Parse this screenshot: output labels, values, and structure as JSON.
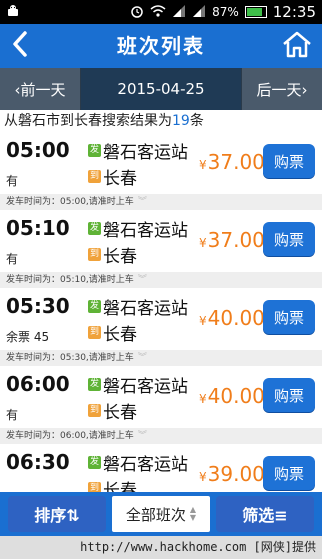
{
  "statusbar": {
    "battery_percent": "87%",
    "battery_level": 0.87,
    "time": "12:35",
    "icons": [
      "android-icon",
      "alarm-icon",
      "wifi-icon",
      "signal-icon",
      "signal-icon",
      "battery-icon"
    ]
  },
  "header": {
    "title": "班次列表",
    "back_icon": "back-arrow-icon",
    "home_icon": "home-icon",
    "color": "#1a6fd1"
  },
  "datenav": {
    "prev": "‹前一天",
    "date": "2015-04-25",
    "next": "后一天›"
  },
  "summary": {
    "prefix": "从磐石市到长春搜索结果为",
    "count": "19",
    "suffix": "条"
  },
  "trips": [
    {
      "time": "05:00",
      "avail": "有",
      "from": "磐石客运站",
      "to": "长春",
      "price": "37.00",
      "buy": "购票",
      "dep": "发车时间为：05:00,请准时上车"
    },
    {
      "time": "05:10",
      "avail": "有",
      "from": "磐石客运站",
      "to": "长春",
      "price": "37.00",
      "buy": "购票",
      "dep": "发车时间为：05:10,请准时上车"
    },
    {
      "time": "05:30",
      "avail": "余票 45",
      "from": "磐石客运站",
      "to": "长春",
      "price": "40.00",
      "buy": "购票",
      "dep": "发车时间为：05:30,请准时上车"
    },
    {
      "time": "06:00",
      "avail": "有",
      "from": "磐石客运站",
      "to": "长春",
      "price": "40.00",
      "buy": "购票",
      "dep": "发车时间为：06:00,请准时上车"
    },
    {
      "time": "06:30",
      "avail": "",
      "from": "磐石客运站",
      "to": "长春",
      "price": "39.00",
      "buy": "购票",
      "dep": ""
    }
  ],
  "badges": {
    "from": "发",
    "to": "到"
  },
  "currency": "¥",
  "bottombar": {
    "sort": "排序⇅",
    "all": "全部班次",
    "filter": "筛选≡"
  },
  "watermark": "http://www.hackhome.com [网侠]提供",
  "colors": {
    "accent": "#1a6fd1",
    "price": "#f07d1a",
    "buy_button": "#1e72d6"
  }
}
